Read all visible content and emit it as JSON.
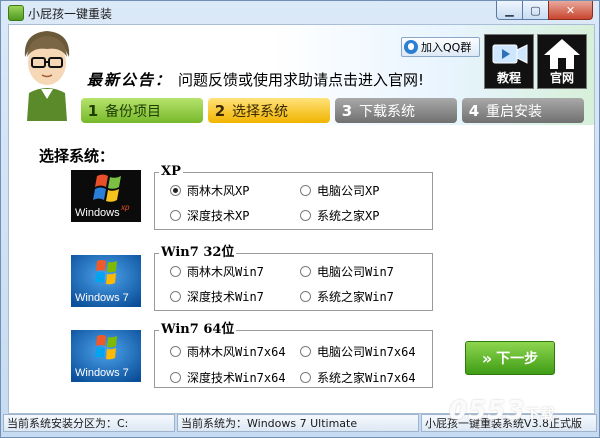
{
  "window": {
    "title": "小屁孩一键重装"
  },
  "header": {
    "notice_label": "最新公告：",
    "notice_text": "问题反馈或使用求助请点击进入官网!",
    "qq_button": "加入QQ群",
    "tutorial_label": "教程",
    "website_label": "官网"
  },
  "steps": [
    {
      "num": "1",
      "label": "备份项目",
      "state": "done"
    },
    {
      "num": "2",
      "label": "选择系统",
      "state": "active"
    },
    {
      "num": "3",
      "label": "下载系统",
      "state": "pending"
    },
    {
      "num": "4",
      "label": "重启安装",
      "state": "pending"
    }
  ],
  "section_title": "选择系统：",
  "groups": [
    {
      "title": "XP",
      "logo": "windows-xp-logo",
      "options": [
        "雨林木风XP",
        "电脑公司XP",
        "深度技术XP",
        "系统之家XP"
      ],
      "selected": 0
    },
    {
      "title": "Win7 32位",
      "logo": "windows-7-logo",
      "options": [
        "雨林木风Win7",
        "电脑公司Win7",
        "深度技术Win7",
        "系统之家Win7"
      ],
      "selected": null
    },
    {
      "title": "Win7 64位",
      "logo": "windows-7-logo",
      "options": [
        "雨林木风Win7x64",
        "电脑公司Win7x64",
        "深度技术Win7x64",
        "系统之家Win7x64"
      ],
      "selected": null
    }
  ],
  "logos": {
    "xp_text": "Windows",
    "xp_sup": "xp",
    "win7_text": "Windows 7"
  },
  "next_button": "下一步",
  "status": {
    "partition": "当前系统安装分区为：C:",
    "current_system": "当前系统为：Windows 7 Ultimate",
    "version": "小屁孩一键重装系统V3.8正式版"
  },
  "watermark": {
    "text": "0553",
    "suffix": "下载"
  },
  "colors": {
    "accent_green": "#77b82a",
    "accent_yellow": "#f1b400",
    "inactive_gray": "#707070"
  }
}
